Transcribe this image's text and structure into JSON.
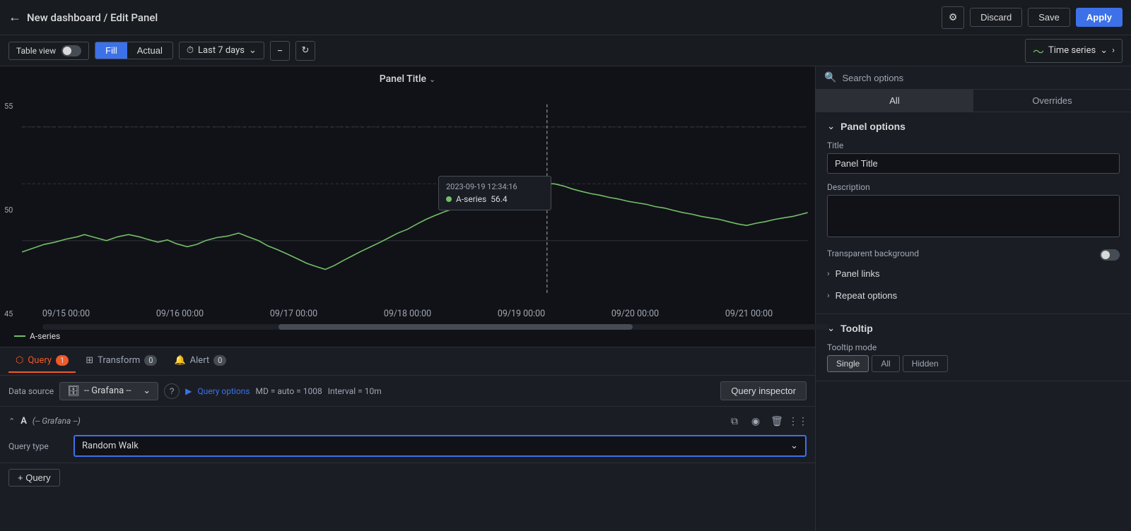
{
  "header": {
    "back_icon": "←",
    "title": "New dashboard / Edit Panel",
    "gear_icon": "⚙",
    "discard_label": "Discard",
    "save_label": "Save",
    "apply_label": "Apply"
  },
  "toolbar": {
    "table_view_label": "Table view",
    "fill_label": "Fill",
    "actual_label": "Actual",
    "time_range": "Last 7 days",
    "zoom_icon": "−",
    "refresh_icon": "↻",
    "panel_type": "Time series",
    "expand_icon": "›"
  },
  "chart": {
    "title": "Panel Title",
    "title_arrow": "⌄",
    "y_labels": [
      "55",
      "50",
      "45"
    ],
    "x_labels": [
      "09/15 00:00",
      "09/16 00:00",
      "09/17 00:00",
      "09/18 00:00",
      "09/19 00:00",
      "09/20 00:00",
      "09/21 00:00"
    ],
    "legend_label": "A-series",
    "tooltip": {
      "time": "2023-09-19 12:34:16",
      "series": "A-series",
      "value": "56.4"
    }
  },
  "bottom": {
    "tabs": [
      {
        "label": "Query",
        "badge": "1",
        "icon": "⬡"
      },
      {
        "label": "Transform",
        "badge": "0",
        "icon": "⊞"
      },
      {
        "label": "Alert",
        "badge": "0",
        "icon": "🔔"
      }
    ],
    "datasource_label": "Data source",
    "datasource_value": "-- Grafana --",
    "query_options_label": "Query options",
    "query_meta": "MD = auto = 1008",
    "interval_label": "Interval = 10m",
    "query_inspector_label": "Query inspector",
    "query": {
      "name": "A",
      "ds_hint": "(-- Grafana --)",
      "collapse_icon": "⌃",
      "copy_icon": "⧉",
      "eye_icon": "◉",
      "trash_icon": "🗑",
      "dots_icon": "⋮⋮"
    },
    "query_type_label": "Query type",
    "query_type_value": "Random Walk",
    "add_query_label": "+ Query"
  },
  "right_panel": {
    "search_placeholder": "Search options",
    "tabs": [
      "All",
      "Overrides"
    ],
    "panel_options": {
      "section_title": "Panel options",
      "title_label": "Title",
      "title_value": "Panel Title",
      "description_label": "Description",
      "description_value": "",
      "transparent_label": "Transparent background"
    },
    "panel_links": {
      "title": "Panel links"
    },
    "repeat_options": {
      "title": "Repeat options"
    },
    "tooltip": {
      "section_title": "Tooltip",
      "mode_label": "Tooltip mode",
      "modes": [
        "Single",
        "All",
        "Hidden"
      ]
    }
  }
}
